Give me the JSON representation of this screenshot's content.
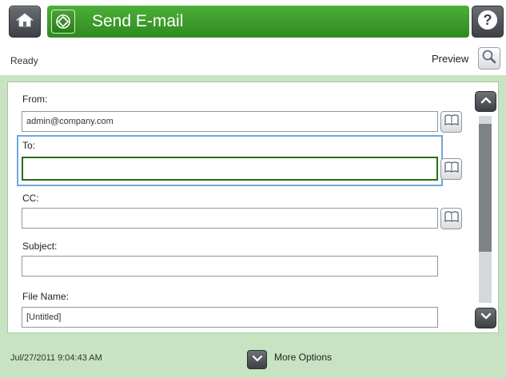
{
  "titlebar": {
    "title": "Send E-mail",
    "home_icon": "home-icon",
    "help_icon": "help-icon",
    "app_icon": "send-diamond-icon"
  },
  "status": {
    "text": "Ready",
    "preview_label": "Preview"
  },
  "form": {
    "from_label": "From:",
    "from_value": "admin@company.com",
    "to_label": "To:",
    "to_value": "",
    "cc_label": "CC:",
    "cc_value": "",
    "subject_label": "Subject:",
    "subject_value": "",
    "filename_label": "File Name:",
    "filename_value": "[Untitled]"
  },
  "footer": {
    "timestamp": "Jul/27/2011 9:04:43 AM",
    "more_options_label": "More Options"
  },
  "colors": {
    "title_green": "#3a9a2a",
    "panel_green": "#c8e3c2",
    "focus_border": "#2a6b1e",
    "group_highlight": "#6fa7d8"
  }
}
